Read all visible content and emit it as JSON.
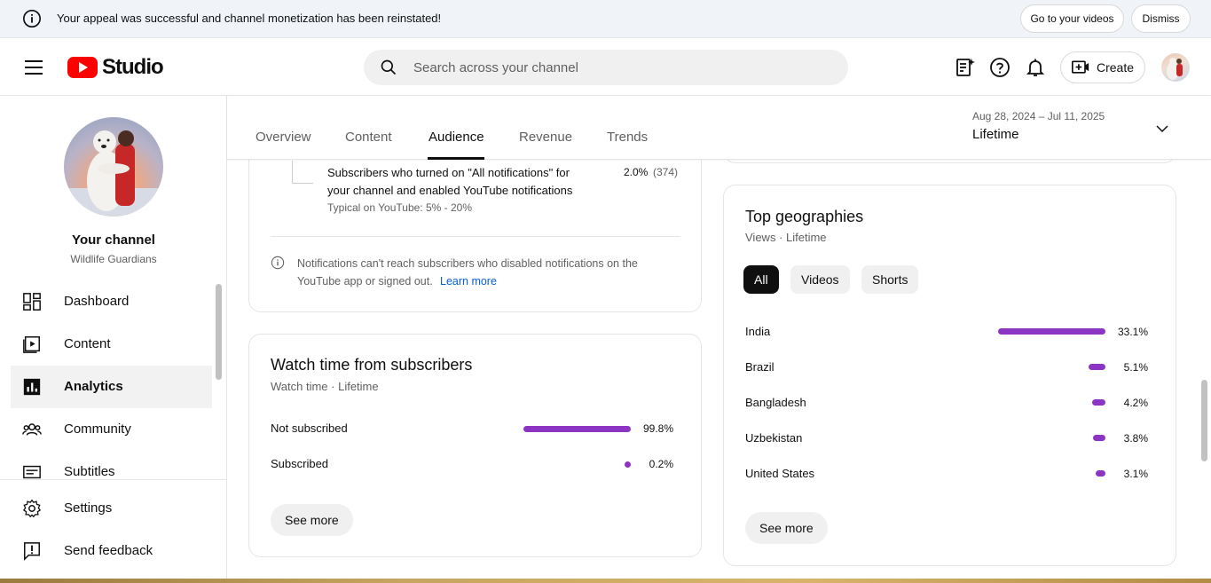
{
  "banner": {
    "message": "Your appeal was successful and channel monetization has been reinstated!",
    "go_to_videos": "Go to your videos",
    "dismiss": "Dismiss"
  },
  "header": {
    "logo_text": "Studio",
    "search_placeholder": "Search across your channel",
    "create_label": "Create"
  },
  "sidebar": {
    "channel_title": "Your channel",
    "channel_name": "Wildlife Guardians",
    "items": [
      {
        "label": "Dashboard",
        "icon": "dashboard-icon"
      },
      {
        "label": "Content",
        "icon": "content-icon"
      },
      {
        "label": "Analytics",
        "icon": "analytics-icon",
        "active": true
      },
      {
        "label": "Community",
        "icon": "community-icon"
      },
      {
        "label": "Subtitles",
        "icon": "subtitles-icon"
      }
    ],
    "bottom_items": [
      {
        "label": "Settings",
        "icon": "gear-icon"
      },
      {
        "label": "Send feedback",
        "icon": "feedback-icon"
      }
    ]
  },
  "tabs": {
    "items": [
      "Overview",
      "Content",
      "Audience",
      "Revenue",
      "Trends"
    ],
    "active": "Audience",
    "date_range": "Aug 28, 2024 – Jul 11, 2025",
    "period": "Lifetime"
  },
  "notifications_card": {
    "row_text_1": "Subscribers who turned on \"All notifications\" for",
    "row_text_2": "your channel and enabled YouTube notifications",
    "typical": "Typical on YouTube: 5% - 20%",
    "pct": "2.0%",
    "count": "(374)",
    "info_text_1": "Notifications can't reach subscribers who disabled notifications on the",
    "info_text_2": "YouTube app or signed out.",
    "learn_more": "Learn more"
  },
  "watch_time_card": {
    "title": "Watch time from subscribers",
    "subtitle": "Watch time · Lifetime",
    "rows": [
      {
        "label": "Not subscribed",
        "pct": "99.8%",
        "value": 99.8
      },
      {
        "label": "Subscribed",
        "pct": "0.2%",
        "value": 0.2
      }
    ],
    "see_more": "See more"
  },
  "geo_card": {
    "title": "Top geographies",
    "subtitle": "Views · Lifetime",
    "chips": [
      "All",
      "Videos",
      "Shorts"
    ],
    "active_chip": "All",
    "rows": [
      {
        "label": "India",
        "pct": "33.1%",
        "value": 33.1
      },
      {
        "label": "Brazil",
        "pct": "5.1%",
        "value": 5.1
      },
      {
        "label": "Bangladesh",
        "pct": "4.2%",
        "value": 4.2
      },
      {
        "label": "Uzbekistan",
        "pct": "3.8%",
        "value": 3.8
      },
      {
        "label": "United States",
        "pct": "3.1%",
        "value": 3.1
      }
    ],
    "see_more": "See more"
  },
  "colors": {
    "bar": "#8c35c2",
    "brand_red": "#ff0000",
    "link": "#065fd4"
  }
}
